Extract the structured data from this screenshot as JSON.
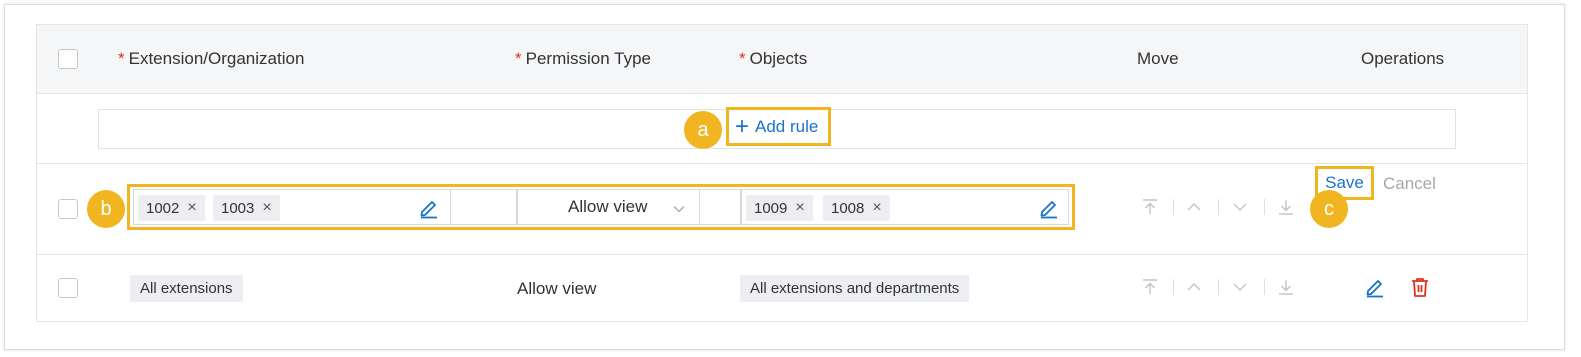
{
  "header": {
    "required_mark": "*",
    "col_extension": "Extension/Organization",
    "col_permission": "Permission Type",
    "col_objects": "Objects",
    "col_move": "Move",
    "col_operations": "Operations"
  },
  "add_rule": {
    "label": "Add rule",
    "plus": "+"
  },
  "edit_row": {
    "extensions": [
      "1002",
      "1003"
    ],
    "permission": "Allow view",
    "objects": [
      "1009",
      "1008"
    ],
    "save_label": "Save",
    "cancel_label": "Cancel"
  },
  "data_row": {
    "extension": "All extensions",
    "permission": "Allow view",
    "objects": "All extensions and departments"
  },
  "callouts": {
    "a": "a",
    "b": "b",
    "c": "c"
  },
  "remove_glyph": "×",
  "colors": {
    "accent": "#1a73c8",
    "highlight": "#f0b521",
    "danger": "#e0301e",
    "muted": "#a8a8a8"
  },
  "icons": [
    "plus-icon",
    "close-icon",
    "pencil-icon",
    "chevron-down-icon",
    "move-top-icon",
    "move-up-icon",
    "move-down-icon",
    "move-bottom-icon",
    "trash-icon"
  ]
}
